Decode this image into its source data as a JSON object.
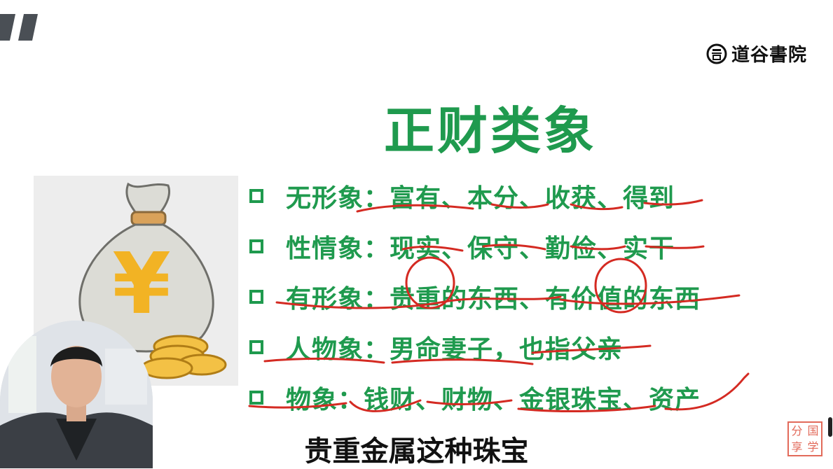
{
  "brand": {
    "name": "道谷書院",
    "icon": "seal-icon"
  },
  "slide": {
    "title": "正财类象",
    "bullets": [
      {
        "label": "无形象：",
        "value": "富有、本分、收获、得到"
      },
      {
        "label": "性情象：",
        "value": "现实、保守、勤俭、实干"
      },
      {
        "label": "有形象：",
        "value": "贵重的东西、有价值的东西"
      },
      {
        "label": "人物象：",
        "value": "男命妻子，也指父亲"
      },
      {
        "label": "物象：",
        "value": "钱财、财物、金银珠宝、资产"
      }
    ],
    "illustration": {
      "symbol": "¥",
      "icon": "money-bag-icon"
    }
  },
  "subtitle": "贵重金属这种珠宝",
  "stamp": {
    "chars": [
      "分",
      "国",
      "享",
      "学"
    ]
  },
  "colors": {
    "accent": "#1f9a4e",
    "annotation": "#d42a22"
  }
}
